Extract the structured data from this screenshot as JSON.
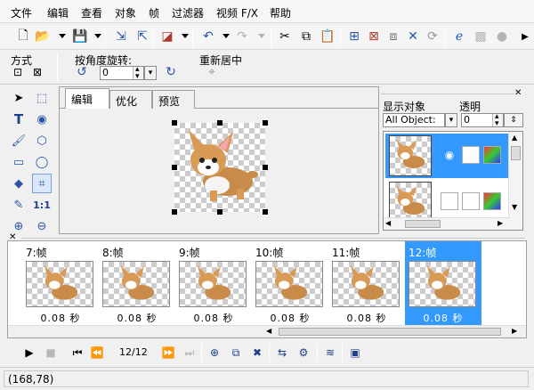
{
  "menu": [
    "文件",
    "编辑",
    "查看",
    "对象",
    "帧",
    "过滤器",
    "视频 F/X",
    "帮助"
  ],
  "propbar": {
    "mode_label": "方式",
    "rotate_label": "按角度旋转:",
    "rotate_value": "0",
    "recenter_label": "重新居中"
  },
  "tabs": [
    "编辑",
    "优化",
    "预览"
  ],
  "objects": {
    "show_label": "显示对象",
    "show_value": "All Object:",
    "opacity_label": "透明",
    "opacity_value": "0"
  },
  "frames": [
    {
      "label": "7:帧",
      "delay": "0.08 秒"
    },
    {
      "label": "8:帧",
      "delay": "0.08 秒"
    },
    {
      "label": "9:帧",
      "delay": "0.08 秒"
    },
    {
      "label": "10:帧",
      "delay": "0.08 秒"
    },
    {
      "label": "11:帧",
      "delay": "0.08 秒"
    },
    {
      "label": "12:帧",
      "delay": "0.08 秒"
    }
  ],
  "playback": {
    "counter": "12/12"
  },
  "status": {
    "coords": "(168,78)"
  },
  "icons": {
    "toolbar": [
      "new-icon",
      "open-icon",
      "save-icon",
      "import-icon",
      "export-icon",
      "color-icon",
      "undo-icon",
      "redo-icon",
      "cut-icon",
      "copy-icon",
      "paste-icon",
      "crop-icon",
      "delete-icon",
      "move-icon",
      "web-icon",
      "preview-icon"
    ],
    "tools": [
      "pointer-icon",
      "select-icon",
      "text-icon",
      "play-icon",
      "brush-icon",
      "fill-icon",
      "eraser-icon",
      "lasso-icon",
      "paint-bucket-icon",
      "crop-tool-icon",
      "eyedropper-icon",
      "actual-size-icon",
      "zoom-in-icon",
      "zoom-out-icon"
    ]
  },
  "colors": {
    "selection": "#3399ff",
    "accent": "#1e5bc6"
  }
}
